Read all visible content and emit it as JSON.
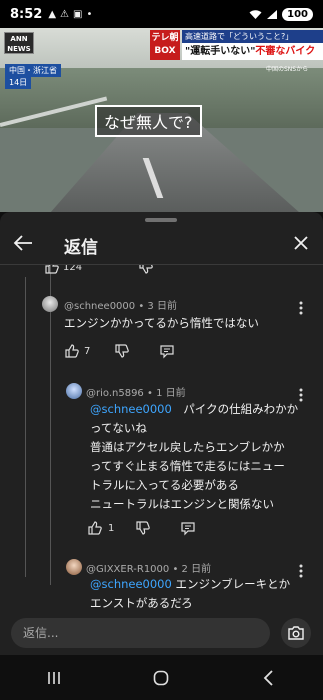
{
  "status_bar": {
    "time": "8:52",
    "battery": "100"
  },
  "video": {
    "channel_logo": "ANN NEWS",
    "location": "中国・浙江省",
    "date_label": "14日",
    "tv_box_label": "テレ朝 BOX",
    "headline_top": "高速道路で「どういうこと?」",
    "headline_main_part1": "\"運転手いない\"",
    "headline_main_part2": "不審なバイク",
    "source_label": "中国のSNSから",
    "caption": "なぜ無人で?"
  },
  "sheet": {
    "title": "返信"
  },
  "comments": [
    {
      "author": "@schnee0000",
      "time": "3 日前",
      "text_lines": [
        "エンジンかかってるから惰性ではない"
      ],
      "likes": "7"
    },
    {
      "author": "@rio.n5896",
      "time": "1 日前",
      "mention": "@schnee0000",
      "text_first": "　パイクの仕組みわかか",
      "text_lines": [
        "ってないね",
        "普通はアクセル戻したらエンブレかか",
        "ってすぐ止まる惰性で走るにはニュー",
        "トラルに入ってる必要がある",
        "ニュートラルはエンジンと関係ない"
      ],
      "likes": "1"
    },
    {
      "author": "@GIXXER-R1000",
      "time": "2 日前",
      "mention": "@schnee0000",
      "text_first": " エンジンブレーキとか",
      "text_lines": [
        "エンストがあるだろ"
      ]
    }
  ],
  "partial_top": {
    "likes": "124"
  },
  "input": {
    "placeholder": "返信..."
  },
  "colors": {
    "background": "#0f0f0f",
    "sheet": "#212121",
    "mention": "#3ea6ff",
    "secondary_text": "#aaaaaa"
  }
}
